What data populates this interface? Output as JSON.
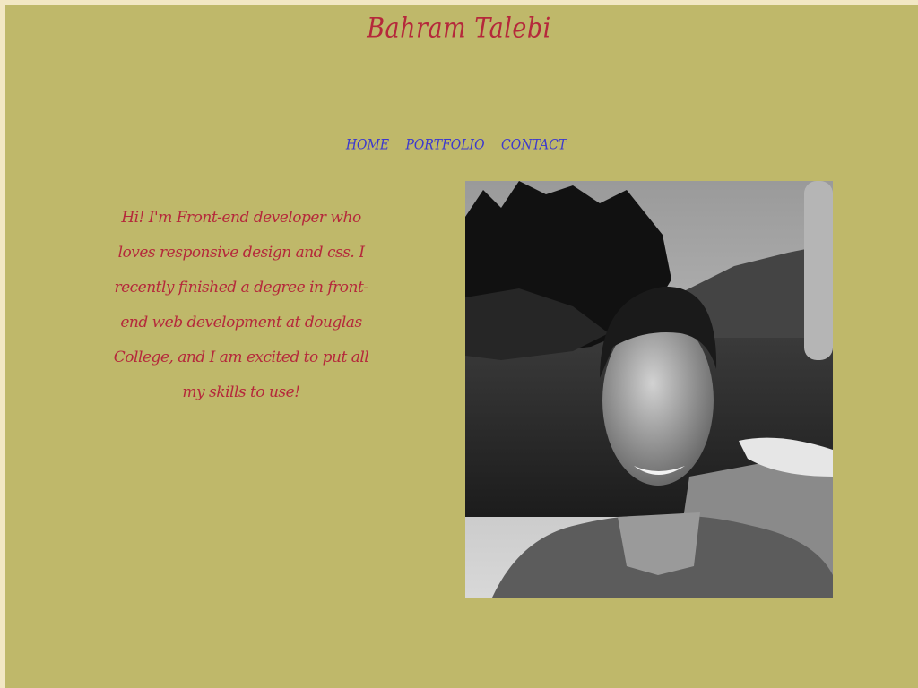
{
  "header": {
    "title": "Bahram Talebi"
  },
  "nav": {
    "items": [
      "HOME",
      "PORTFOLIO",
      "CONTACT"
    ]
  },
  "main": {
    "bio": "Hi! I'm Front-end developer who loves responsive design and css. I recently finished a degree in front-end web development at douglas College, and I am excited to put all my skills to use!"
  },
  "colors": {
    "background": "#bfb86a",
    "title": "#b5283b",
    "nav_link": "#3b38cf",
    "bio_text": "#b5283b"
  }
}
